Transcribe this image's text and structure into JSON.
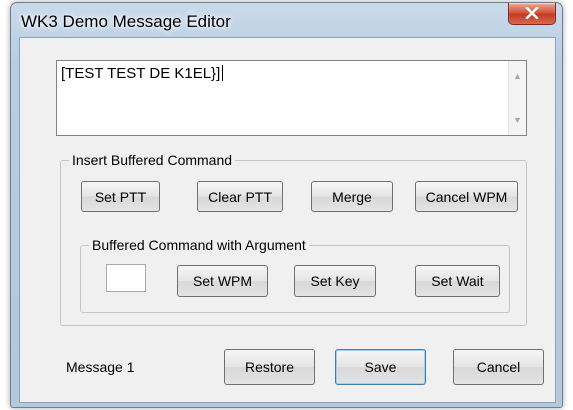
{
  "window": {
    "title": "WK3 Demo Message Editor",
    "close_glyph": "✕"
  },
  "message": {
    "text": "[TEST TEST DE K1EL}]",
    "scroll_up": "▲",
    "scroll_down": "▼"
  },
  "buffered_group": {
    "legend": "Insert Buffered Command",
    "buttons": {
      "set_ptt": "Set PTT",
      "clear_ptt": "Clear PTT",
      "merge": "Merge",
      "cancel_wpm": "Cancel WPM"
    }
  },
  "argument_group": {
    "legend": "Buffered Command with Argument",
    "argument_value": "",
    "buttons": {
      "set_wpm": "Set WPM",
      "set_key": "Set Key",
      "set_wait": "Set Wait"
    }
  },
  "footer": {
    "status": "Message 1",
    "restore": "Restore",
    "save": "Save",
    "cancel": "Cancel"
  },
  "colors": {
    "title_bar": "#b9cde2",
    "close_button": "#c23a22",
    "dialog_face": "#f0f0f0"
  }
}
